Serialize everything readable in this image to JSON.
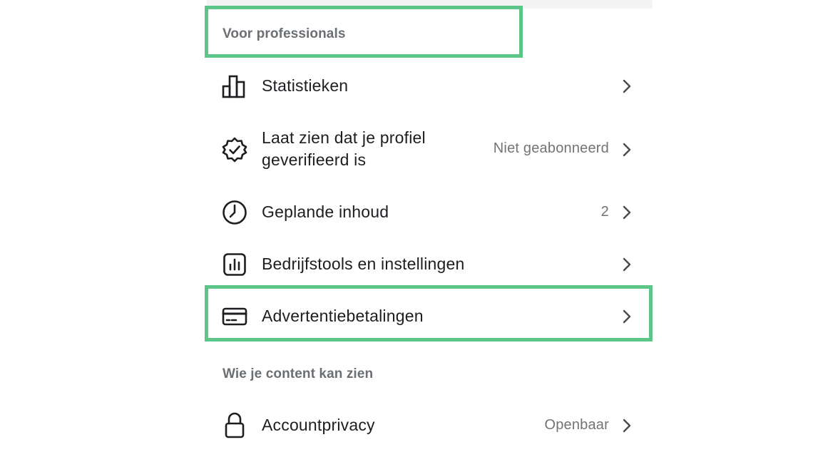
{
  "section_professionals": {
    "title": "Voor professionals"
  },
  "items": [
    {
      "label": "Statistieken",
      "meta": "",
      "icon": "bar-chart-icon"
    },
    {
      "label_line1": "Laat zien dat je profiel",
      "label_line2": "geverifieerd is",
      "meta": "Niet geabonneerd",
      "icon": "verified-badge-icon"
    },
    {
      "label": "Geplande inhoud",
      "meta": "2",
      "icon": "clock-icon"
    },
    {
      "label": "Bedrijfstools en instellingen",
      "meta": "",
      "icon": "business-tools-icon"
    },
    {
      "label": "Advertentiebetalingen",
      "meta": "",
      "icon": "credit-card-icon"
    }
  ],
  "section_visibility": {
    "title": "Wie je content kan zien"
  },
  "privacy_item": {
    "label": "Accountprivacy",
    "meta": "Openbaar",
    "icon": "lock-icon"
  },
  "colors": {
    "highlight": "#5cc689",
    "text": "#1c1e21",
    "muted": "#737373"
  }
}
